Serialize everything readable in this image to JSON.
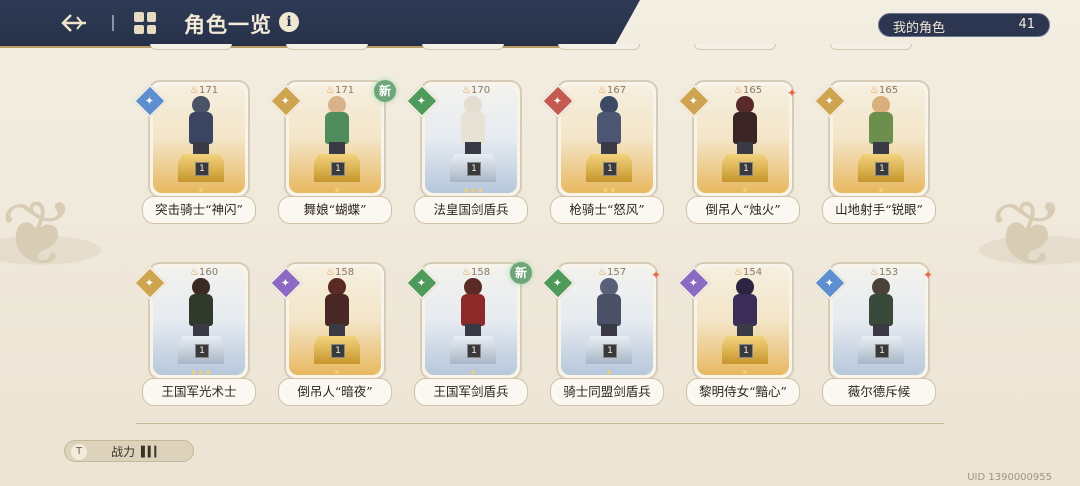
{
  "header": {
    "title": "角色一览",
    "count_label": "我的角色",
    "count_value": "41"
  },
  "characters": [
    {
      "name": "突击骑士“神闪”",
      "power": "171",
      "rarity": "gold",
      "class": "blue",
      "stars": "★",
      "level": "1",
      "new": false,
      "spark": false
    },
    {
      "name": "舞娘“蝴蝶”",
      "power": "171",
      "rarity": "gold",
      "class": "gold",
      "stars": "★",
      "level": "1",
      "new": true,
      "spark": false
    },
    {
      "name": "法皇国剑盾兵",
      "power": "170",
      "rarity": "blue",
      "class": "green",
      "stars": "★★★",
      "level": "1",
      "new": false,
      "spark": false
    },
    {
      "name": "枪骑士“怒风”",
      "power": "167",
      "rarity": "gold",
      "class": "red",
      "stars": "★★",
      "level": "1",
      "new": false,
      "spark": false
    },
    {
      "name": "倒吊人“烛火”",
      "power": "165",
      "rarity": "gold",
      "class": "gold",
      "stars": "★",
      "level": "1",
      "new": false,
      "spark": true
    },
    {
      "name": "山地射手“锐眼”",
      "power": "165",
      "rarity": "gold",
      "class": "gold",
      "stars": "★",
      "level": "1",
      "new": false,
      "spark": false
    },
    {
      "name": "王国军光术士",
      "power": "160",
      "rarity": "blue",
      "class": "gold",
      "stars": "★★★",
      "level": "1",
      "new": false,
      "spark": false
    },
    {
      "name": "倒吊人“暗夜”",
      "power": "158",
      "rarity": "gold",
      "class": "purple",
      "stars": "★",
      "level": "1",
      "new": false,
      "spark": false
    },
    {
      "name": "王国军剑盾兵",
      "power": "158",
      "rarity": "blue",
      "class": "green",
      "stars": "★",
      "level": "1",
      "new": true,
      "spark": false
    },
    {
      "name": "骑士同盟剑盾兵",
      "power": "157",
      "rarity": "blue",
      "class": "green",
      "stars": "★",
      "level": "1",
      "new": false,
      "spark": true
    },
    {
      "name": "黎明侍女“黯心”",
      "power": "154",
      "rarity": "gold",
      "class": "purple",
      "stars": "★",
      "level": "1",
      "new": false,
      "spark": false
    },
    {
      "name": "薇尔德斥候",
      "power": "153",
      "rarity": "blue",
      "class": "blue",
      "stars": "",
      "level": "1",
      "new": false,
      "spark": true
    }
  ],
  "labels": {
    "new_tag": "新"
  },
  "footer": {
    "sort_label": "战力",
    "sort_icon": "T",
    "uid": "UID 1390000955"
  },
  "colors": {
    "header_bg": "#2a3450",
    "accent_gold": "#b79b66"
  }
}
